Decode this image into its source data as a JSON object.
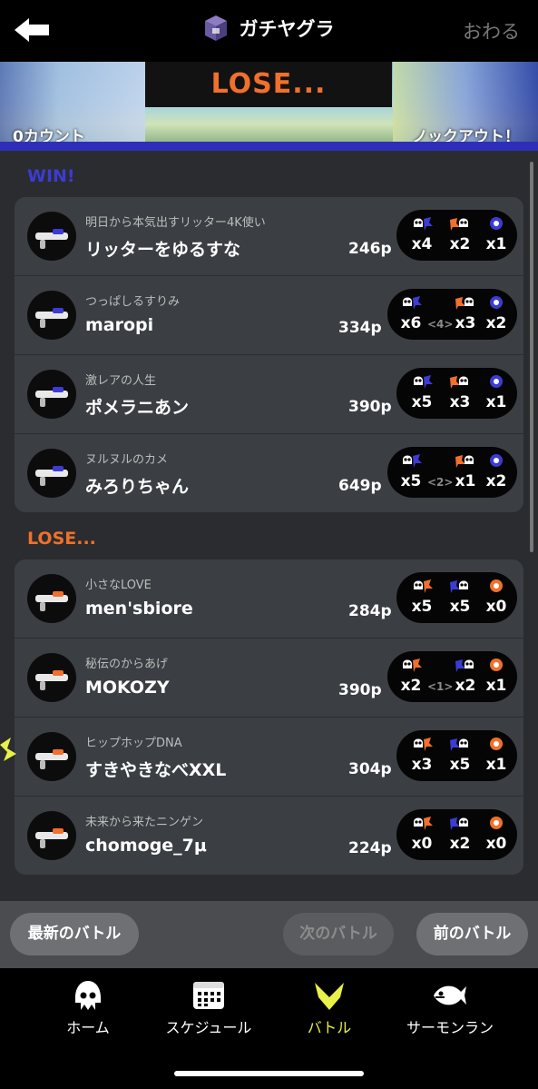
{
  "header": {
    "title": "ガチヤグラ",
    "quit_label": "おわる",
    "back_icon": "arrow-left-icon",
    "mode_icon": "tower-icon"
  },
  "banner": {
    "result": "LOSE...",
    "my_count": "0カウント",
    "enemy_count": "ノックアウト！"
  },
  "sections": {
    "win_label": "WIN!",
    "lose_label": "LOSE..."
  },
  "win_team": [
    {
      "nickname": "明日から本気出すリッター4K使い",
      "name": "リッターをゆるすな",
      "points": "246p",
      "kills": "x4",
      "assists": "",
      "deaths": "x2",
      "specials": "x1"
    },
    {
      "nickname": "つっぱしるすりみ",
      "name": "maropi",
      "points": "334p",
      "kills": "x6",
      "assists": "<4>",
      "deaths": "x3",
      "specials": "x2"
    },
    {
      "nickname": "激レアの人生",
      "name": "ポメラニあン",
      "points": "390p",
      "kills": "x5",
      "assists": "",
      "deaths": "x3",
      "specials": "x1"
    },
    {
      "nickname": "ヌルヌルのカメ",
      "name": "みろりちゃん",
      "points": "649p",
      "kills": "x5",
      "assists": "<2>",
      "deaths": "x1",
      "specials": "x2"
    }
  ],
  "lose_team": [
    {
      "nickname": "小さなLOVE",
      "name": "men'sbiore",
      "points": "284p",
      "kills": "x5",
      "assists": "",
      "deaths": "x5",
      "specials": "x0"
    },
    {
      "nickname": "秘伝のからあげ",
      "name": "MOKOZY",
      "points": "390p",
      "kills": "x2",
      "assists": "<1>",
      "deaths": "x2",
      "specials": "x1"
    },
    {
      "nickname": "ヒップホップDNA",
      "name": "すきやきなべXXL",
      "points": "304p",
      "kills": "x3",
      "assists": "",
      "deaths": "x5",
      "specials": "x1"
    },
    {
      "nickname": "未来から来たニンゲン",
      "name": "chomoge_7μ",
      "points": "224p",
      "kills": "x0",
      "assists": "",
      "deaths": "x2",
      "specials": "x0"
    }
  ],
  "nav_buttons": {
    "latest": "最新のバトル",
    "next": "次のバトル",
    "prev": "前のバトル"
  },
  "tabs": [
    {
      "label": "ホーム",
      "icon": "squid-icon"
    },
    {
      "label": "スケジュール",
      "icon": "calendar-icon"
    },
    {
      "label": "バトル",
      "icon": "battle-icon"
    },
    {
      "label": "サーモンラン",
      "icon": "salmon-icon"
    }
  ],
  "colors": {
    "win_team": "#3c3cd2",
    "lose_team": "#f0702c",
    "active_tab": "#e9f04a"
  }
}
